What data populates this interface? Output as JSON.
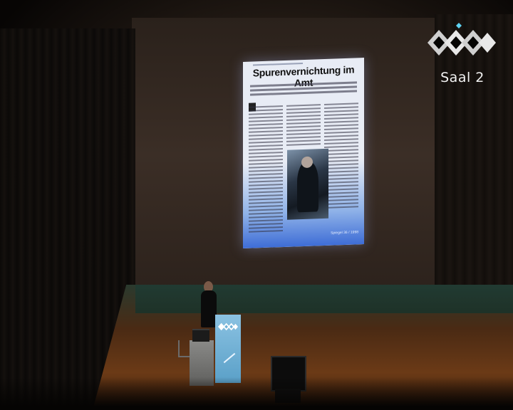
{
  "broadcast": {
    "hall_label": "Saal 2",
    "logo_icon": "congress-diamond-logo-icon"
  },
  "slide": {
    "title": "Spurenvernichtung im Amt",
    "source": "Spiegel 36 / 1998"
  },
  "colors": {
    "slide_accent": "#3e6dd6",
    "lectern": "#6fb0d6",
    "floor": "#6b3a16"
  }
}
